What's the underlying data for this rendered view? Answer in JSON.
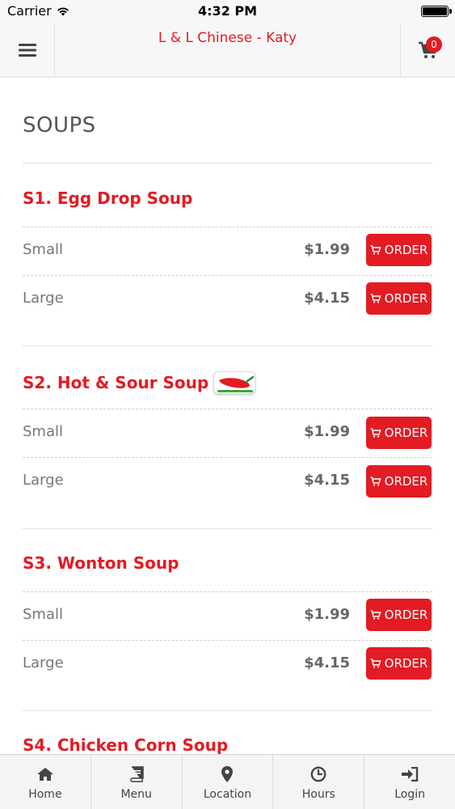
{
  "status_bar": {
    "carrier": "Carrier",
    "time": "4:32 PM"
  },
  "header": {
    "title": "L & L Chinese - Katy",
    "cart_count": "0",
    "menu_icon": "hamburger-icon",
    "cart_icon": "cart-icon"
  },
  "section": {
    "title": "SOUPS"
  },
  "items": [
    {
      "name": "S1. Egg Drop Soup",
      "spicy": false,
      "options": [
        {
          "size": "Small",
          "price": "$1.99",
          "button": "ORDER"
        },
        {
          "size": "Large",
          "price": "$4.15",
          "button": "ORDER"
        }
      ]
    },
    {
      "name": "S2. Hot & Sour Soup",
      "spicy": true,
      "options": [
        {
          "size": "Small",
          "price": "$1.99",
          "button": "ORDER"
        },
        {
          "size": "Large",
          "price": "$4.15",
          "button": "ORDER"
        }
      ]
    },
    {
      "name": "S3. Wonton Soup",
      "spicy": false,
      "options": [
        {
          "size": "Small",
          "price": "$1.99",
          "button": "ORDER"
        },
        {
          "size": "Large",
          "price": "$4.15",
          "button": "ORDER"
        }
      ]
    },
    {
      "name": "S4. Chicken Corn Soup",
      "spicy": false,
      "options": []
    }
  ],
  "tabs": [
    {
      "label": "Home",
      "icon": "home-icon"
    },
    {
      "label": "Menu",
      "icon": "book-icon"
    },
    {
      "label": "Location",
      "icon": "map-pin-icon"
    },
    {
      "label": "Hours",
      "icon": "clock-icon"
    },
    {
      "label": "Login",
      "icon": "login-icon"
    }
  ],
  "colors": {
    "accent": "#e31b23",
    "header_bg": "#f7f7f7",
    "tab_bg": "#f4f4f4"
  }
}
